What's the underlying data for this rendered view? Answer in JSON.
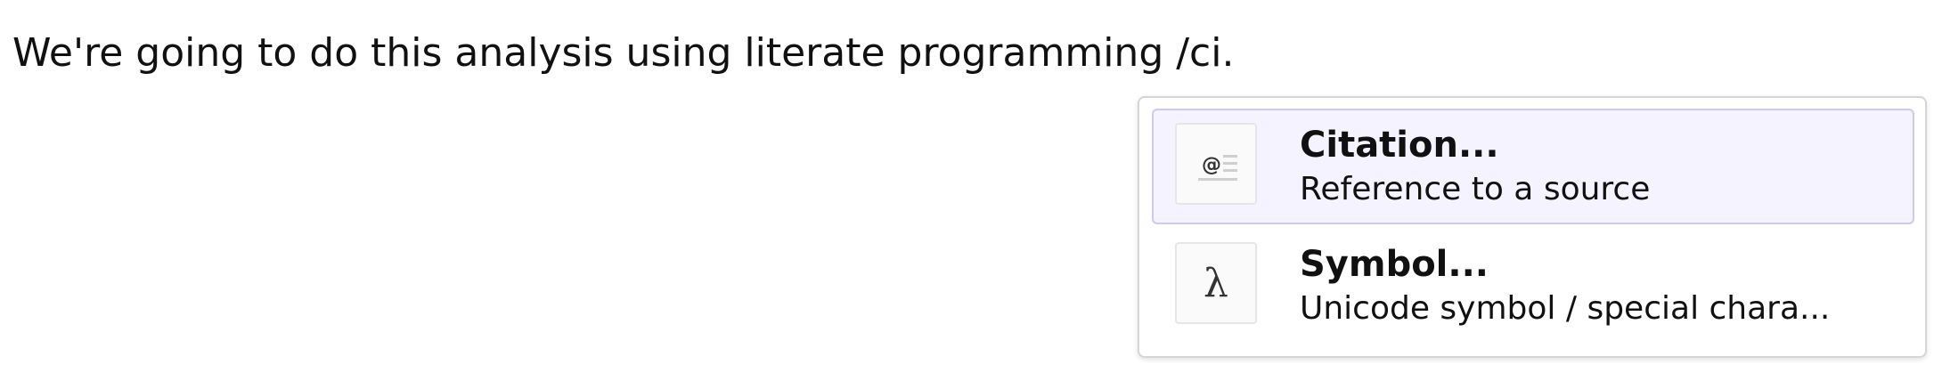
{
  "document": {
    "line": "We're going to do this analysis using literate programming /ci."
  },
  "completion_popup": {
    "selected_index": 0,
    "items": [
      {
        "title": "Citation...",
        "description": "Reference to a source",
        "icon": "citation-icon"
      },
      {
        "title": "Symbol...",
        "description": "Unicode symbol / special chara...",
        "icon": "lambda-icon",
        "glyph": "λ"
      }
    ]
  }
}
